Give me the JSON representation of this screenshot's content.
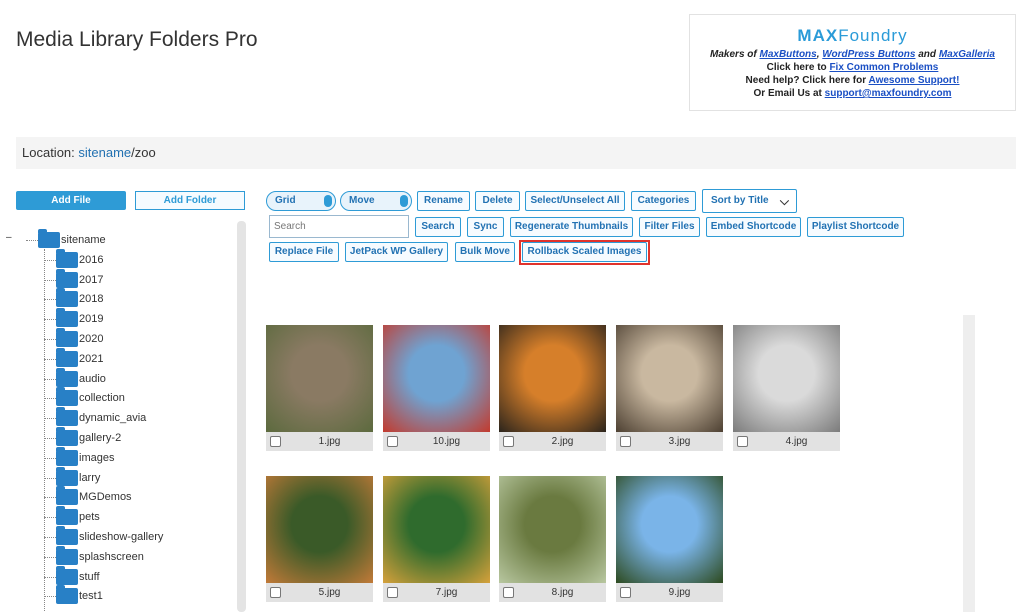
{
  "app_title": "Media Library Folders Pro",
  "promo": {
    "logo_a": "MAX",
    "logo_b": "Foundry",
    "makers_prefix": "Makers of ",
    "link1": "MaxButtons",
    "sep1": ", ",
    "link2": "WordPress Buttons",
    "sep2": " and ",
    "link3": "MaxGalleria",
    "fix_prefix": "Click here to ",
    "fix_link": "Fix Common Problems",
    "help_prefix": "Need help? Click here for ",
    "help_link": "Awesome Support!",
    "email_prefix": "Or Email Us at ",
    "email_link": "support@maxfoundry.com"
  },
  "location": {
    "label": "Location: ",
    "root": "sitename",
    "path": "/zoo"
  },
  "left": {
    "add_file": "Add File",
    "add_folder": "Add Folder"
  },
  "tree": {
    "toggle": "–",
    "root": "sitename",
    "folders": [
      "2016",
      "2017",
      "2018",
      "2019",
      "2020",
      "2021",
      "audio",
      "collection",
      "dynamic_avia",
      "gallery-2",
      "images",
      "larry",
      "MGDemos",
      "pets",
      "slideshow-gallery",
      "splashscreen",
      "stuff",
      "test1"
    ]
  },
  "toolbar": {
    "grid": "Grid",
    "move": "Move",
    "rename": "Rename",
    "delete": "Delete",
    "select_all": "Select/Unselect All",
    "categories": "Categories",
    "sort": "Sort by Title",
    "search_placeholder": "Search",
    "search_btn": "Search",
    "sync": "Sync",
    "regen": "Regenerate Thumbnails",
    "filter": "Filter Files",
    "embed": "Embed Shortcode",
    "playlist": "Playlist Shortcode",
    "replace": "Replace File",
    "jetpack": "JetPack WP Gallery",
    "bulk_move": "Bulk Move",
    "rollback": "Rollback Scaled Images"
  },
  "images": [
    {
      "name": "1.jpg",
      "c1": "#8a7a63",
      "c2": "#5c6a3e"
    },
    {
      "name": "10.jpg",
      "c1": "#6fa3d2",
      "c2": "#c33a2d"
    },
    {
      "name": "2.jpg",
      "c1": "#d67f2a",
      "c2": "#2b241c"
    },
    {
      "name": "3.jpg",
      "c1": "#c9b8a0",
      "c2": "#4d4032"
    },
    {
      "name": "4.jpg",
      "c1": "#dadada",
      "c2": "#7b7b7b"
    },
    {
      "name": "5.jpg",
      "c1": "#3a5a28",
      "c2": "#c27a38"
    },
    {
      "name": "7.jpg",
      "c1": "#2f6b2d",
      "c2": "#d6a13b"
    },
    {
      "name": "8.jpg",
      "c1": "#6a7a40",
      "c2": "#b8c7a0"
    },
    {
      "name": "9.jpg",
      "c1": "#7ab4e8",
      "c2": "#2d4a1f"
    }
  ]
}
